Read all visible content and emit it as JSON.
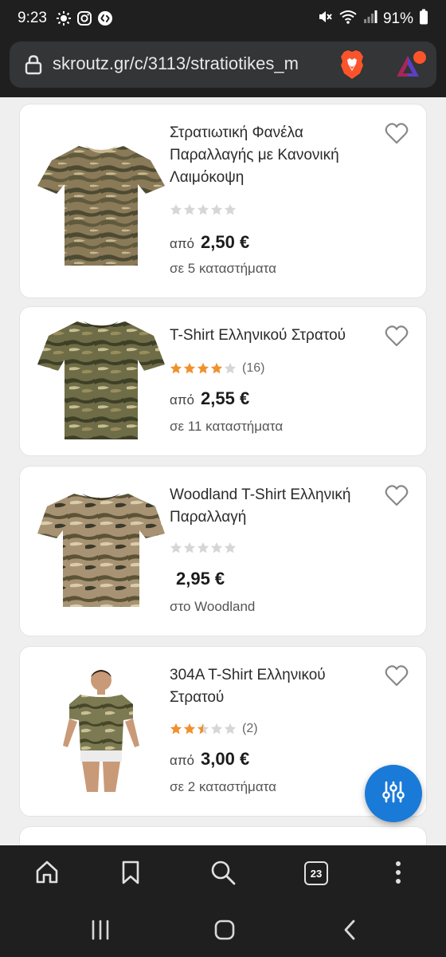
{
  "status_bar": {
    "time": "9:23",
    "battery": "91%",
    "icons": [
      "sun-icon",
      "instagram-icon",
      "shazam-icon",
      "mute-icon",
      "wifi-icon",
      "signal-icon",
      "battery-icon"
    ]
  },
  "browser": {
    "url": "skroutz.gr/c/3113/stratiotikes_m",
    "tab_count": "23"
  },
  "colors": {
    "accent": "#1a7ad8",
    "star": "#f0912e",
    "star_empty": "#d6d6d6",
    "chrome": "#1f1f1f"
  },
  "products": [
    {
      "title": "Στρατιωτική Φανέλα Παραλλαγής με Κανονική Λαιμόκοψη",
      "rating": 0,
      "reviews": "",
      "price_prefix": "από",
      "price": "2,50 €",
      "stores": "σε 5 καταστήματα"
    },
    {
      "title": "T-Shirt Ελληνικού Στρατού",
      "rating": 4,
      "reviews": "(16)",
      "price_prefix": "από",
      "price": "2,55 €",
      "stores": "σε 11 καταστήματα"
    },
    {
      "title": "Woodland T-Shirt Ελληνική Παραλλαγή",
      "rating": 0,
      "reviews": "",
      "price_prefix": "",
      "price": "2,95 €",
      "stores": "στο Woodland"
    },
    {
      "title": "304A T-Shirt Ελληνικού Στρατού",
      "rating": 2.5,
      "reviews": "(2)",
      "price_prefix": "από",
      "price": "3,00 €",
      "stores": "σε 2 καταστήματα"
    }
  ]
}
